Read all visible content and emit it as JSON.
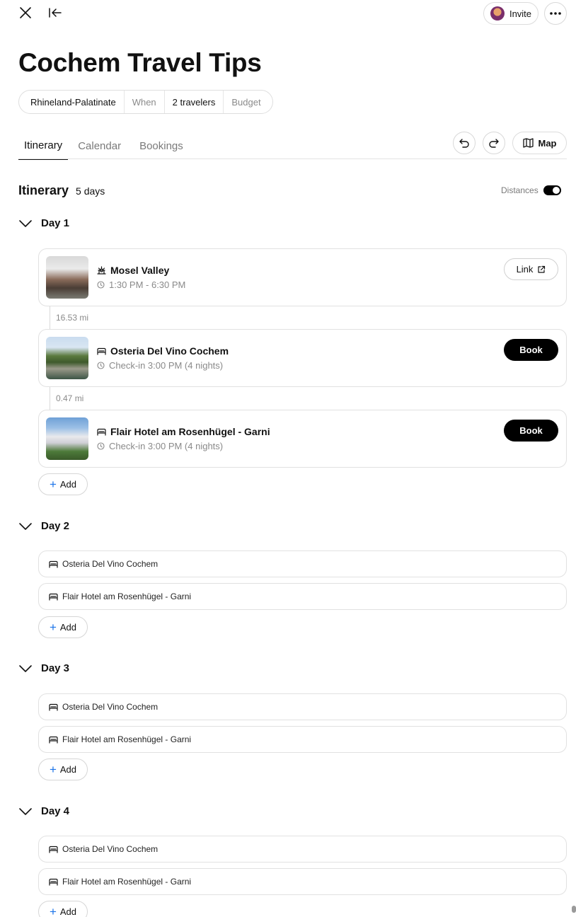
{
  "header": {
    "title": "Cochem Travel Tips",
    "invite_label": "Invite",
    "chips": [
      "Rhineland-Palatinate",
      "When",
      "2 travelers",
      "Budget"
    ]
  },
  "tabs": [
    {
      "label": "Itinerary",
      "active": true
    },
    {
      "label": "Calendar",
      "active": false
    },
    {
      "label": "Bookings",
      "active": false
    }
  ],
  "toolbar": {
    "map_label": "Map"
  },
  "itinerary": {
    "heading": "Itinerary",
    "duration": "5 days",
    "distances_label": "Distances",
    "distances_on": true
  },
  "day1": {
    "label": "Day 1",
    "items": [
      {
        "name": "Mosel Valley",
        "sub": "1:30 PM - 6:30 PM",
        "action": "Link",
        "icon": "attraction-icon"
      },
      {
        "name": "Osteria Del Vino Cochem",
        "sub": "Check-in 3:00 PM (4 nights)",
        "action": "Book",
        "icon": "bed-icon"
      },
      {
        "name": "Flair Hotel am Rosenhügel - Garni",
        "sub": "Check-in 3:00 PM (4 nights)",
        "action": "Book",
        "icon": "bed-icon"
      }
    ],
    "distances": [
      "16.53 mi",
      "0.47 mi"
    ]
  },
  "day2": {
    "label": "Day 2",
    "items": [
      "Osteria Del Vino Cochem",
      "Flair Hotel am Rosenhügel - Garni"
    ]
  },
  "day3": {
    "label": "Day 3",
    "items": [
      "Osteria Del Vino Cochem",
      "Flair Hotel am Rosenhügel - Garni"
    ]
  },
  "day4": {
    "label": "Day 4",
    "items": [
      "Osteria Del Vino Cochem",
      "Flair Hotel am Rosenhügel - Garni"
    ]
  },
  "add_label": "Add",
  "colors": {
    "accent": "#1a73e8",
    "primary": "#000000",
    "muted": "#8a8a8a",
    "border": "#e1e1e1"
  }
}
